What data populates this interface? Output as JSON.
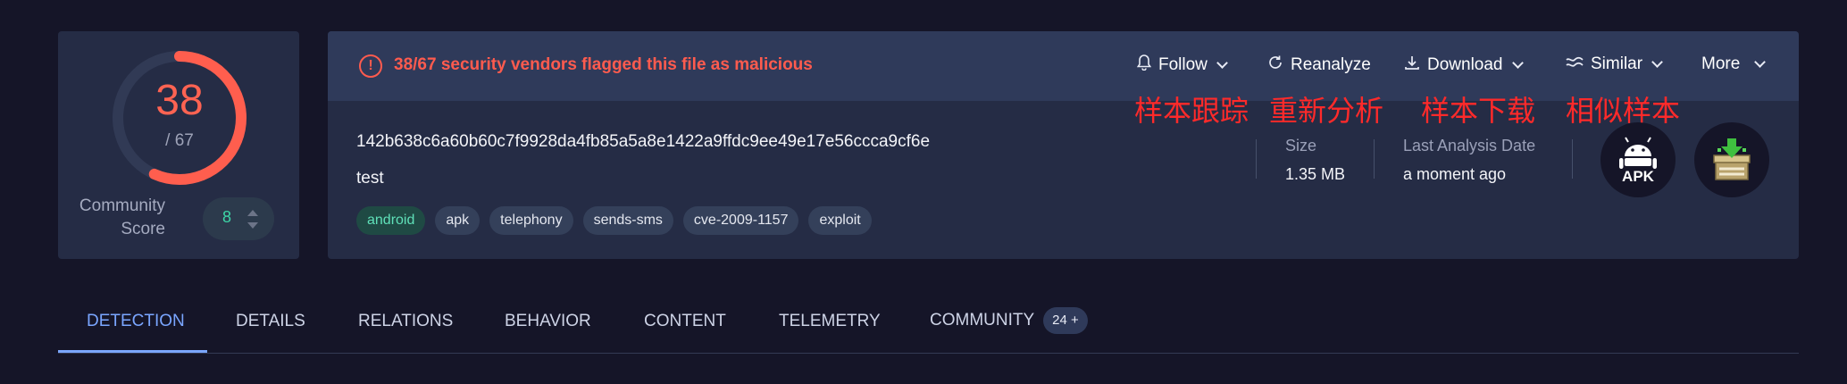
{
  "score": {
    "detections": "38",
    "total": "/ 67",
    "ratio": 0.567,
    "ring_color": "#ff5e4e",
    "community_label": "Community Score",
    "community_value": "8"
  },
  "alert": {
    "icon": "exclamation-circle-icon",
    "text": "38/67 security vendors flagged this file as malicious",
    "color": "#ff5b4e"
  },
  "actions": {
    "follow": {
      "label": "Follow",
      "icon": "bell-icon"
    },
    "reanalyze": {
      "label": "Reanalyze",
      "icon": "refresh-icon"
    },
    "download": {
      "label": "Download",
      "icon": "download-icon"
    },
    "similar": {
      "label": "Similar",
      "icon": "similar-icon"
    },
    "more": {
      "label": "More"
    }
  },
  "annotations": {
    "follow": "样本跟踪",
    "reanalyze": "重新分析",
    "download": "样本下载",
    "similar": "相似样本"
  },
  "file": {
    "hash": "142b638c6a60b60c7f9928da4fb85a5a8e1422a9ffdc9ee49e17e56ccca9cf6e",
    "name": "test",
    "tags": [
      "android",
      "apk",
      "telephony",
      "sends-sms",
      "cve-2009-1157",
      "exploit"
    ]
  },
  "meta": {
    "size_label": "Size",
    "size_value": "1.35 MB",
    "date_label": "Last Analysis Date",
    "date_value": "a moment ago"
  },
  "file_type": {
    "label": "APK",
    "icon": "android-icon"
  },
  "tabs": [
    {
      "label": "DETECTION",
      "active": true
    },
    {
      "label": "DETAILS"
    },
    {
      "label": "RELATIONS"
    },
    {
      "label": "BEHAVIOR"
    },
    {
      "label": "CONTENT"
    },
    {
      "label": "TELEMETRY"
    },
    {
      "label": "COMMUNITY",
      "badge": "24 +"
    }
  ]
}
